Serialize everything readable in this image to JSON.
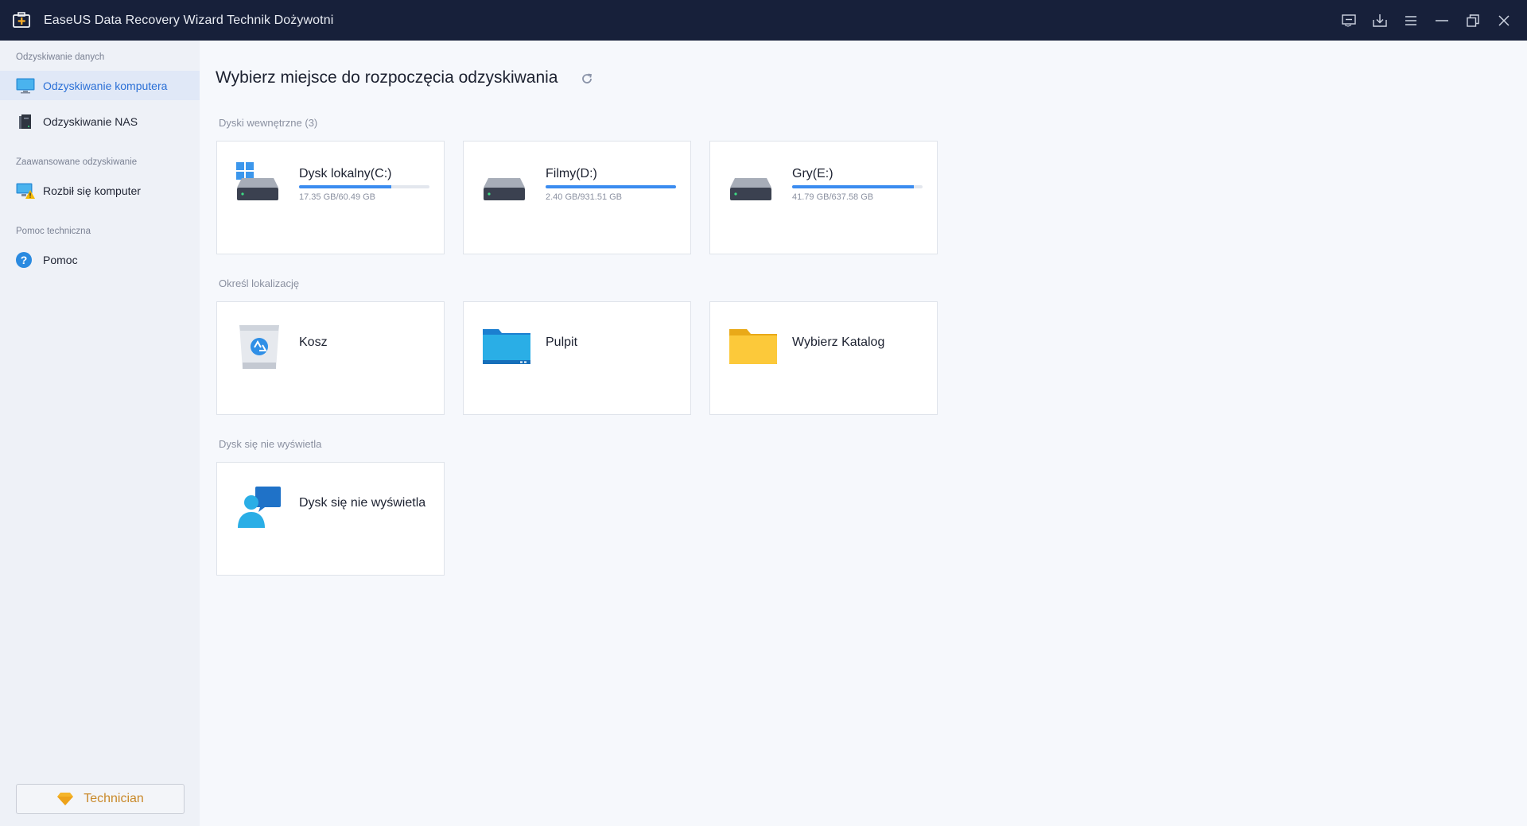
{
  "window": {
    "title": "EaseUS Data Recovery Wizard Technik Dożywotni",
    "controls": [
      "feedback-icon",
      "download-icon",
      "menu-icon",
      "minimize-icon",
      "restore-icon",
      "close-icon"
    ]
  },
  "sidebar": {
    "sections": [
      {
        "label": "Odzyskiwanie danych"
      },
      {
        "label": "Zaawansowane odzyskiwanie"
      },
      {
        "label": "Pomoc techniczna"
      }
    ],
    "items": [
      {
        "label": "Odzyskiwanie komputera",
        "icon": "monitor-icon",
        "active": true
      },
      {
        "label": "Odzyskiwanie NAS",
        "icon": "nas-icon",
        "active": false
      },
      {
        "label": "Rozbił się komputer",
        "icon": "crashed-pc-icon",
        "active": false
      },
      {
        "label": "Pomoc",
        "icon": "help-icon",
        "active": false
      }
    ],
    "technician_label": "Technician"
  },
  "main": {
    "title": "Wybierz miejsce do rozpoczęcia odzyskiwania",
    "sections": {
      "internal": "Dyski wewnętrzne (3)",
      "location": "Określ lokalizację",
      "missing": "Dysk się nie wyświetla"
    },
    "drives": [
      {
        "name": "Dysk lokalny(C:)",
        "size": "17.35 GB/60.49 GB",
        "used_fraction": 0.71
      },
      {
        "name": "Filmy(D:)",
        "size": "2.40 GB/931.51 GB",
        "used_fraction": 1.0
      },
      {
        "name": "Gry(E:)",
        "size": "41.79 GB/637.58 GB",
        "used_fraction": 0.93
      }
    ],
    "locations": [
      {
        "name": "Kosz",
        "icon": "recycle-bin-icon"
      },
      {
        "name": "Pulpit",
        "icon": "desktop-folder-icon"
      },
      {
        "name": "Wybierz Katalog",
        "icon": "folder-icon"
      }
    ],
    "missing_card": {
      "name": "Dysk się nie wyświetla",
      "icon": "support-chat-icon"
    }
  },
  "colors": {
    "titlebar": "#17203a",
    "accent": "#3b8cf0",
    "active_text": "#2a6fd6",
    "technician": "#c9892a"
  }
}
